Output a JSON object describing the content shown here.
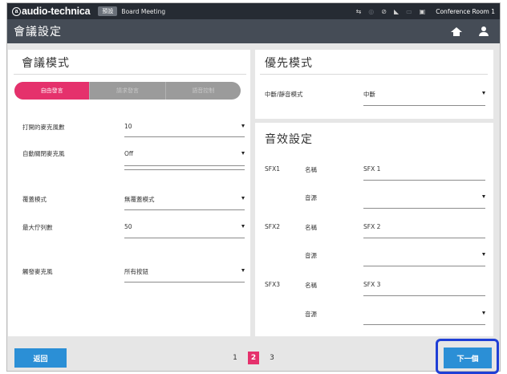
{
  "statusbar": {
    "brand": "audio-technica",
    "preset_badge": "預設",
    "meeting_name": "Board Meeting",
    "icons": [
      "usb-icon",
      "headset-icon",
      "link-icon",
      "volume-icon",
      "speaker-icon",
      "monitor-icon"
    ],
    "room_name": "Conference Room 1"
  },
  "titlebar": {
    "title": "會議設定",
    "icons": [
      "home-icon",
      "user-icon"
    ]
  },
  "meeting_mode": {
    "title": "會議模式",
    "segments": [
      {
        "label": "自由發言",
        "active": true
      },
      {
        "label": "請求發言",
        "active": false
      },
      {
        "label": "語音控制",
        "active": false
      }
    ],
    "rows": [
      {
        "label": "打開的麥克風數",
        "value": "10"
      },
      {
        "label": "自動關閉麥克風",
        "value": "Off"
      },
      {
        "label": "覆蓋模式",
        "value": "無覆蓋模式"
      },
      {
        "label": "最大佇列數",
        "value": "50"
      },
      {
        "label": "觸發麥克風",
        "value": "所有按鈕"
      }
    ]
  },
  "priority_mode": {
    "title": "優先模式",
    "label": "中斷/靜音模式",
    "value": "中斷"
  },
  "sfx_settings": {
    "title": "音效設定",
    "name_label": "名稱",
    "source_label": "音源",
    "items": [
      {
        "id": "SFX1",
        "name": "SFX 1",
        "source": ""
      },
      {
        "id": "SFX2",
        "name": "SFX 2",
        "source": ""
      },
      {
        "id": "SFX3",
        "name": "SFX 3",
        "source": ""
      }
    ]
  },
  "footer": {
    "back_label": "返回",
    "pages": [
      "1",
      "2",
      "3"
    ],
    "current_page": "2",
    "next_label": "下一個"
  },
  "colors": {
    "accent_pink": "#e5316c",
    "button_blue": "#2b8fd6",
    "highlight_blue": "#1f3fd6",
    "titlebar": "#454c56",
    "statusbar": "#262b33"
  }
}
